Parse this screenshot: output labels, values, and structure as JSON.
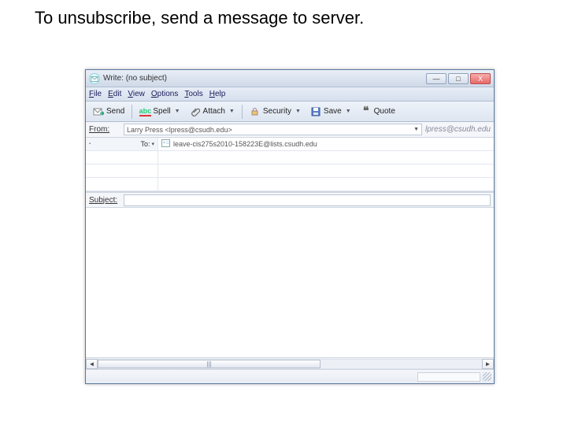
{
  "caption": "To unsubscribe, send a message to server.",
  "window": {
    "title": "Write: (no subject)",
    "controls": {
      "min": "—",
      "max": "□",
      "close": "X"
    }
  },
  "menus": {
    "file": "ile",
    "file_u": "F",
    "edit": "dit",
    "edit_u": "E",
    "view": "iew",
    "view_u": "V",
    "options": "ptions",
    "options_u": "O",
    "tools": "ools",
    "tools_u": "T",
    "help": "elp",
    "help_u": "H"
  },
  "toolbar": {
    "send": "Send",
    "spell": "Spell",
    "attach": "Attach",
    "security": "Security",
    "save": "Save",
    "quote": "Quote"
  },
  "from": {
    "label": "From:",
    "value": "Larry Press <lpress@csudh.edu>",
    "trail": "lpress@csudh.edu"
  },
  "recipients": {
    "to_label": "To:",
    "to_value": "leave-cis275s2010-158223E@lists.csudh.edu"
  },
  "subject": {
    "label": "Subject:",
    "value": ""
  },
  "scroll": {
    "thumb_marks": "|||"
  }
}
